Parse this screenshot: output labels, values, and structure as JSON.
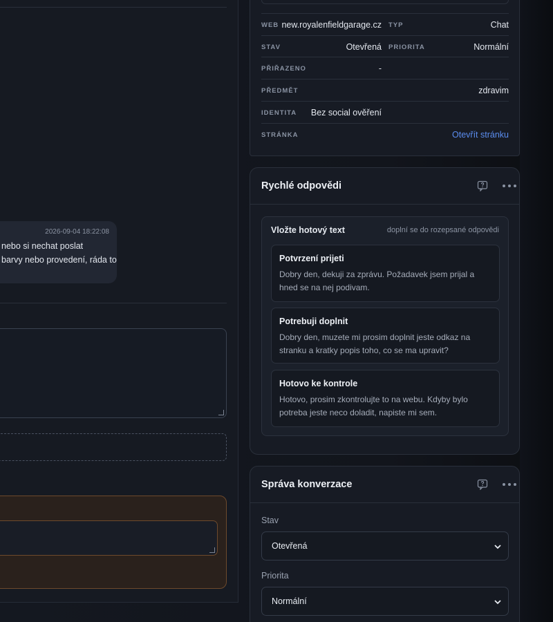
{
  "message": {
    "time": "2026-09-04 18:22:08",
    "line1": "nebo si nechat poslat",
    "line2": "barvy nebo provedení, ráda to"
  },
  "info": {
    "web_label": "WEB",
    "web_value": "new.royalenfieldgarage.cz",
    "type_label": "TYP",
    "type_value": "Chat",
    "state_label": "STAV",
    "state_value": "Otevřená",
    "priority_label": "PRIORITA",
    "priority_value": "Normální",
    "assigned_label": "PŘIŘAZENO",
    "assigned_value": "-",
    "subject_label": "PŘEDMĚT",
    "subject_value": "zdravim",
    "identity_label": "IDENTITA",
    "identity_value": "Bez social ověření",
    "page_label": "STRÁNKA",
    "page_link": "Otevřít stránku"
  },
  "quick_replies": {
    "title": "Rychlé odpovědi",
    "panel_heading": "Vložte hotový text",
    "panel_hint": "doplní se do rozepsané odpovědi",
    "items": [
      {
        "title": "Potvrzení prijeti",
        "text": "Dobry den, dekuji za zprávu. Požadavek jsem prijal a hned se na nej podivam."
      },
      {
        "title": "Potrebuji doplnit",
        "text": "Dobry den, muzete mi prosim doplnit jeste odkaz na stranku a kratky popis toho, co se ma upravit?"
      },
      {
        "title": "Hotovo ke kontrole",
        "text": "Hotovo, prosim zkontrolujte to na webu. Kdyby bylo potreba jeste neco doladit, napiste mi sem."
      }
    ]
  },
  "conversation": {
    "title": "Správa konverzace",
    "state_label": "Stav",
    "state_value": "Otevřená",
    "priority_label": "Priorita",
    "priority_value": "Normální"
  },
  "icons": {
    "help": "help-bubble-icon",
    "more": "more-dots-icon",
    "chevron": "chevron-down-icon"
  },
  "colors": {
    "accent_link": "#5b8def",
    "note_border": "#6e4a2c"
  }
}
